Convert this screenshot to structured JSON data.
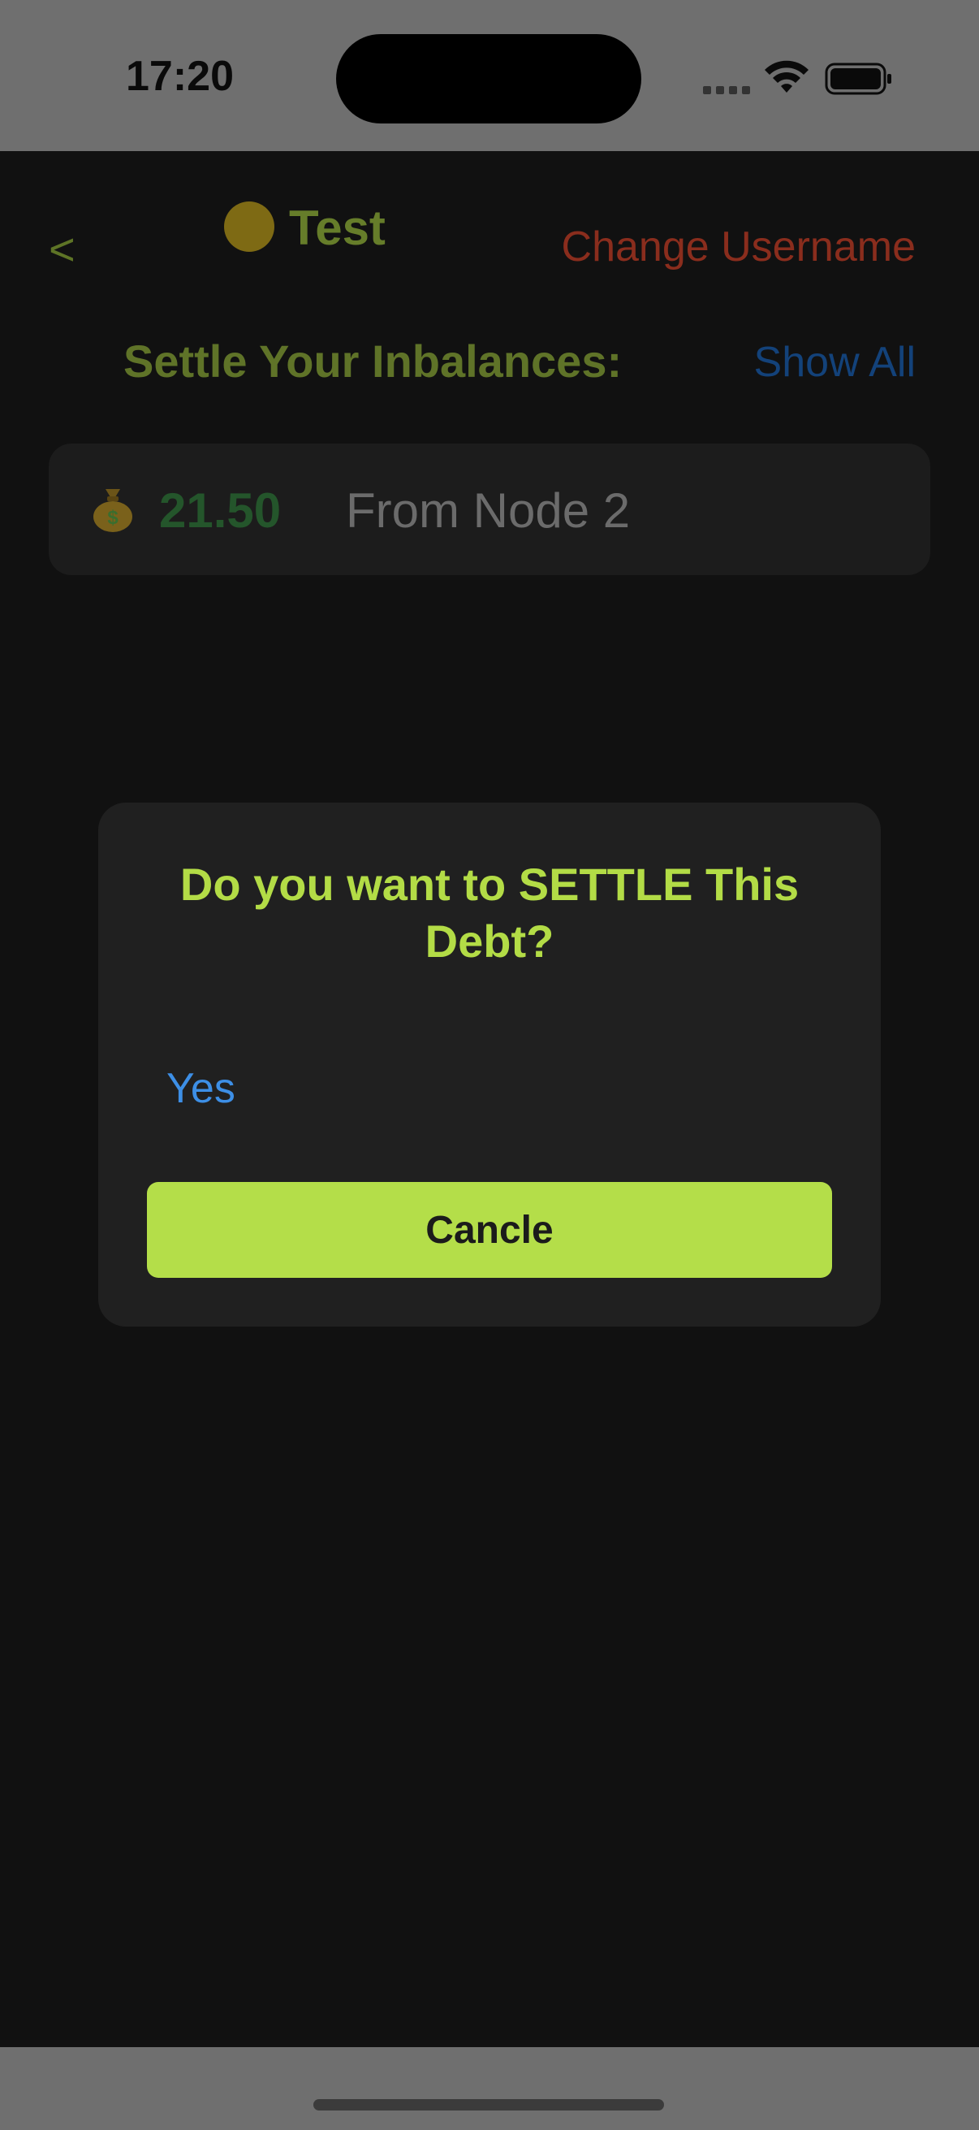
{
  "status_bar": {
    "time": "17:20"
  },
  "header": {
    "back_label": "<",
    "title": "Test",
    "title_icon": "grinning-face-emoji",
    "change_username_label": "Change Username"
  },
  "inbalances": {
    "heading": "Settle Your Inbalances:",
    "show_all_label": "Show All",
    "items": [
      {
        "icon": "money-bag-emoji",
        "amount": "21.50",
        "from_text": "From Node 2"
      }
    ]
  },
  "dialog": {
    "title": "Do you want to SETTLE This Debt?",
    "yes_label": "Yes",
    "cancel_label": "Cancle"
  },
  "colors": {
    "accent_green": "#b4de49",
    "link_blue": "#3d8fe6",
    "danger_red": "#8a2d1d",
    "background": "#111111"
  }
}
